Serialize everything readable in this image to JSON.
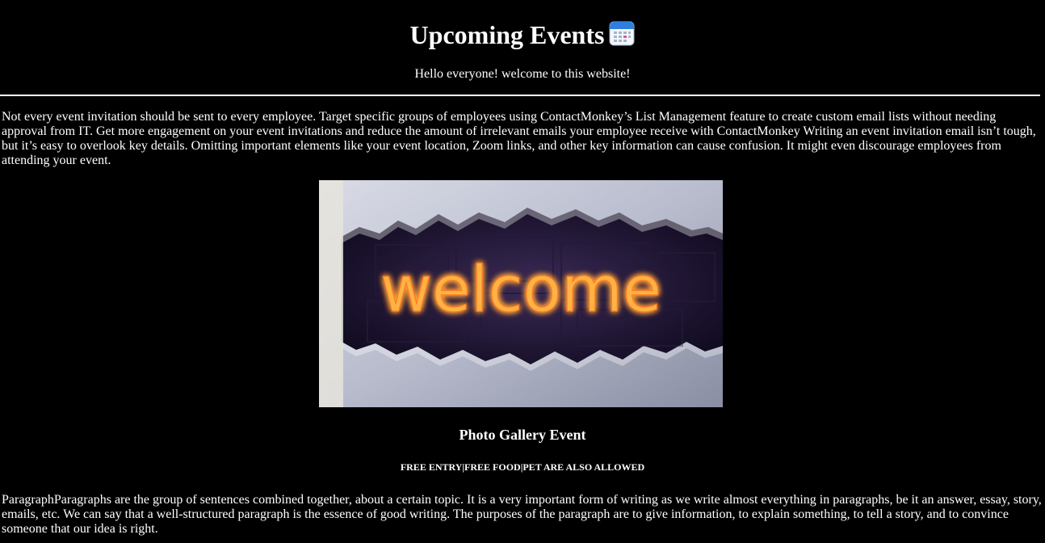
{
  "header": {
    "title": "Upcoming Events",
    "title_icon": "calendar-icon",
    "greeting": "Hello everyone! welcome to this website!"
  },
  "intro": {
    "text": "Not every event invitation should be sent to every employee. Target specific groups of employees using ContactMonkey’s List Management feature to create custom email lists without needing approval from IT. Get more engagement on your event invitations and reduce the amount of irrelevant emails your employee receive with ContactMonkey Writing an event invitation email isn’t tough, but it’s easy to overlook key details. Omitting important elements like your event location, Zoom links, and other key information can cause confusion. It might even discourage employees from attending your event."
  },
  "banner": {
    "word": "welcome",
    "glow_color": "#ffb347"
  },
  "event": {
    "title": "Photo Gallery Event",
    "tagline": "FREE ENTRY|FREE FOOD|PET ARE ALSO ALLOWED"
  },
  "outro": {
    "text": "ParagraphParagraphs are the group of sentences combined together, about a certain topic. It is a very important form of writing as we write almost everything in paragraphs, be it an answer, essay, story, emails, etc. We can say that a well-structured paragraph is the essence of good writing. The purposes of the paragraph are to give information, to explain something, to tell a story, and to convince someone that our idea is right."
  },
  "colors": {
    "background": "#000000",
    "text": "#ffffff"
  }
}
